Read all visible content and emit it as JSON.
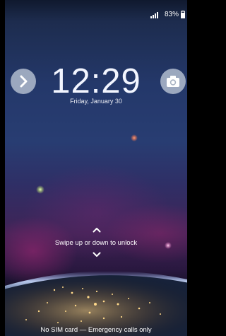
{
  "status_bar": {
    "battery_percent": "83%",
    "signal_icon": "signal-bars-icon",
    "battery_icon": "battery-icon"
  },
  "lock_screen": {
    "time": "12:29",
    "date": "Friday, January 30",
    "unlock_hint": "Swipe up or down to unlock",
    "carrier_status": "No SIM card — Emergency calls only",
    "left_shortcut_icon": "chevron-right-icon",
    "right_shortcut_icon": "camera-icon"
  },
  "colors": {
    "shortcut_button_bg": "#bec8d7",
    "sky_top": "#1d2c4e",
    "sky_glow": "#402356"
  }
}
